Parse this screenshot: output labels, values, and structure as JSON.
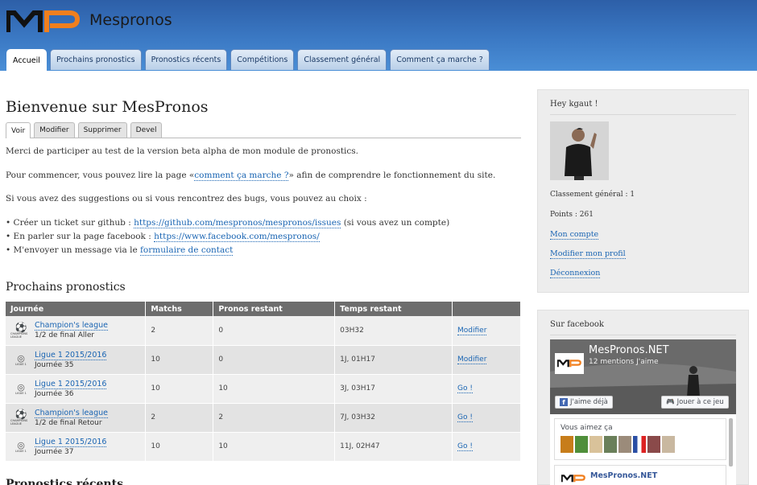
{
  "header": {
    "site_name": "Mespronos",
    "nav": [
      {
        "label": "Accueil",
        "active": true
      },
      {
        "label": "Prochains pronostics",
        "active": false
      },
      {
        "label": "Pronostics récents",
        "active": false
      },
      {
        "label": "Compétitions",
        "active": false
      },
      {
        "label": "Classement général",
        "active": false
      },
      {
        "label": "Comment ça marche ?",
        "active": false
      }
    ]
  },
  "main": {
    "title": "Bienvenue sur MesPronos",
    "tabs": [
      {
        "label": "Voir",
        "active": true
      },
      {
        "label": "Modifier",
        "active": false
      },
      {
        "label": "Supprimer",
        "active": false
      },
      {
        "label": "Devel",
        "active": false
      }
    ],
    "intro": "Merci de participer au test de la version beta alpha de mon module de pronostics.",
    "para2_before": "Pour commencer, vous pouvez lire la page «",
    "para2_link": "comment ça marche ?",
    "para2_after": "» afin de comprendre le fonctionnement du site.",
    "para3": "Si vous avez des suggestions ou si vous rencontrez des bugs, vous pouvez au choix :",
    "bullet1_before": "• Créer un ticket sur github : ",
    "bullet1_link": "https://github.com/mespronos/mespronos/issues",
    "bullet1_after": " (si vous avez un compte)",
    "bullet2_before": "• En parler sur la page facebook : ",
    "bullet2_link": "https://www.facebook.com/mespronos/",
    "bullet3_before": "• M'envoyer un message via le ",
    "bullet3_link": "formulaire de contact",
    "upcoming_title": "Prochains pronostics",
    "recent_title": "Pronostics récents"
  },
  "table": {
    "headers": [
      "Journée",
      "Matchs",
      "Pronos restant",
      "Temps restant",
      ""
    ],
    "rows": [
      {
        "icon": "champions-league-icon",
        "competition": "Champion's league",
        "day": "1/2 de final Aller",
        "matchs": "2",
        "pronos": "0",
        "time": "03H32",
        "action": "Modifier"
      },
      {
        "icon": "ligue1-icon",
        "competition": "Ligue 1 2015/2016",
        "day": "Journée 35",
        "matchs": "10",
        "pronos": "0",
        "time": "1J, 01H17",
        "action": "Modifier"
      },
      {
        "icon": "ligue1-icon",
        "competition": "Ligue 1 2015/2016",
        "day": "Journée 36",
        "matchs": "10",
        "pronos": "10",
        "time": "3J, 03H17",
        "action": "Go !"
      },
      {
        "icon": "champions-league-icon",
        "competition": "Champion's league",
        "day": "1/2 de final Retour",
        "matchs": "2",
        "pronos": "2",
        "time": "7J, 03H32",
        "action": "Go !"
      },
      {
        "icon": "ligue1-icon",
        "competition": "Ligue 1 2015/2016",
        "day": "Journée 37",
        "matchs": "10",
        "pronos": "10",
        "time": "11J, 02H47",
        "action": "Go !"
      }
    ],
    "icon_texts": {
      "champions_caption": "CHAMPIONS LEAGUE",
      "ligue_caption": "LIGUE 1"
    }
  },
  "sidebar": {
    "user_block_title": "Hey kgaut !",
    "ranking": "Classement général : 1",
    "points": "Points : 261",
    "links": [
      "Mon compte",
      "Modifier mon profil",
      "Déconnexion"
    ],
    "fb_block_title": "Sur facebook",
    "fb": {
      "page_name": "MesPronos.NET",
      "likes": "12 mentions J'aime",
      "like_button": "J'aime déjà",
      "play_button": "Jouer à ce jeu",
      "friends_label": "Vous aimez ça",
      "post_name": "MesPronos.NET"
    }
  },
  "colors": {
    "header_blue": "#3b79c4",
    "link_blue": "#1a65b3",
    "logo_orange": "#f07f1e",
    "table_header": "#6d6d6d",
    "facebook_blue": "#4267b2"
  }
}
